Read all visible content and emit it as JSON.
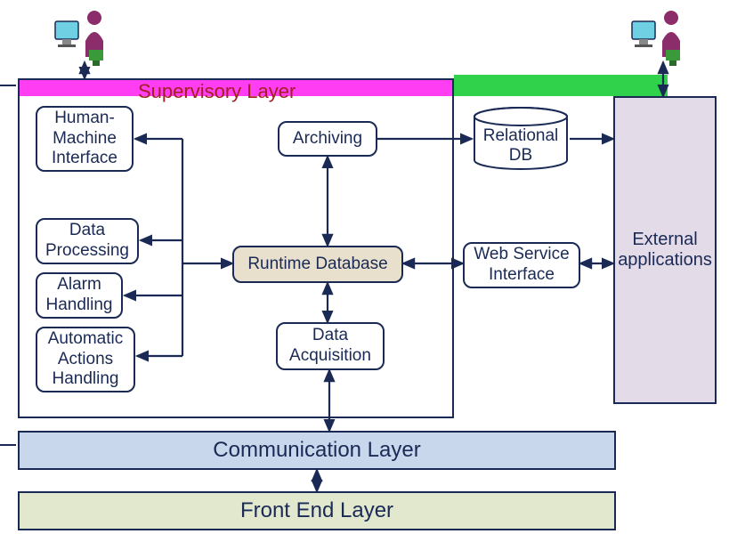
{
  "title": "Supervisory Layer",
  "boxes": {
    "hmi": "Human-\nMachine\nInterface",
    "data_processing": "Data\nProcessing",
    "alarm": "Alarm\nHandling",
    "auto_actions": "Automatic\nActions\nHandling",
    "archiving": "Archiving",
    "runtime_db": "Runtime Database",
    "data_acq": "Data\nAcquisition",
    "relational_db": "Relational\nDB",
    "web_service": "Web  Service\nInterface",
    "external_apps": "External\napplications"
  },
  "layers": {
    "comm": "Communication Layer",
    "front": "Front End Layer"
  },
  "colors": {
    "border": "#1a2a55",
    "text": "#1a2a55",
    "title": "#a32020",
    "runtime_bg": "#e8e0cc",
    "comm_bg": "#c8d7ec",
    "front_bg": "#e2e8ce",
    "external_bg": "#e3dbe8",
    "magenta": "#ff3df2",
    "green": "#2fd24a"
  }
}
